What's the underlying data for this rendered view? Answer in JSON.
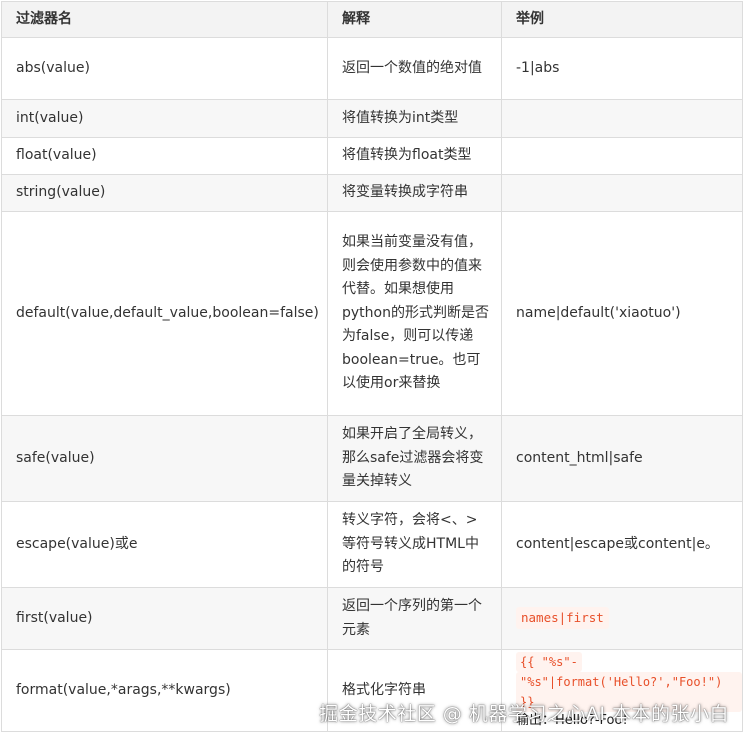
{
  "headers": {
    "name": "过滤器名",
    "desc": "解释",
    "example": "举例"
  },
  "rows": [
    {
      "name": "abs(value)",
      "desc": "返回一个数值的绝对值",
      "example": "-1|abs"
    },
    {
      "name": "int(value)",
      "desc": "将值转换为int类型",
      "example": ""
    },
    {
      "name": "float(value)",
      "desc": "将值转换为float类型",
      "example": ""
    },
    {
      "name": "string(value)",
      "desc": "将变量转换成字符串",
      "example": ""
    },
    {
      "name": "default(value,default_value,boolean=false)",
      "desc": "如果当前变量没有值，则会使用参数中的值来代替。如果想使用python的形式判断是否为false，则可以传递boolean=true。也可以使用or来替换",
      "example": "name|default('xiaotuo')"
    },
    {
      "name": "safe(value)",
      "desc": "如果开启了全局转义，那么safe过滤器会将变量关掉转义",
      "example": "content_html|safe"
    },
    {
      "name": "escape(value)或e",
      "desc": "转义字符，会将<、>等符号转义成HTML中的符号",
      "example": "content|escape或content|e。"
    },
    {
      "name": "first(value)",
      "desc": "返回一个序列的第一个元素",
      "example": "names|first"
    },
    {
      "name": "format(value,*arags,**kwargs)",
      "desc": "格式化字符串",
      "example_code_line1": "{{ \"%s\"-",
      "example_code_line2": "\"%s\"|format('Hello?',\"Foo!\") }}",
      "example_output": "输出：Hello?-Foo!"
    }
  ],
  "watermark": "掘金技术社区 @ 机器学习之心AI 本本的张小白"
}
